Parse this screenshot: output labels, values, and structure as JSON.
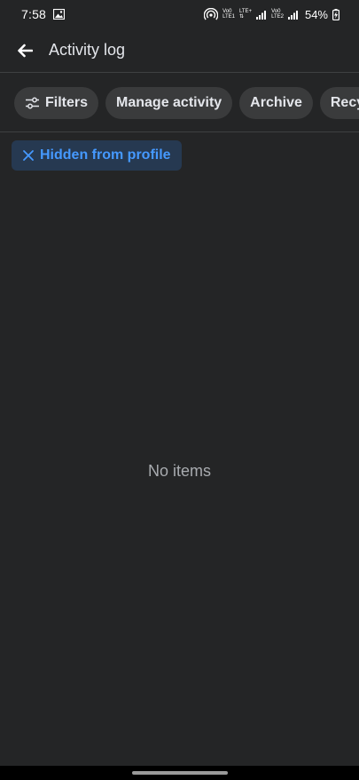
{
  "status_bar": {
    "time": "7:58",
    "sim1_top": "Vo0",
    "sim1_bottom": "LTE1",
    "sim1_extra": "LTE+",
    "sim2_top": "Vo0",
    "sim2_bottom": "LTE2",
    "battery": "54%"
  },
  "header": {
    "title": "Activity log"
  },
  "chips": {
    "filters": "Filters",
    "manage_activity": "Manage activity",
    "archive": "Archive",
    "recycle": "Recyc"
  },
  "active_filter": {
    "label": "Hidden from profile"
  },
  "empty_state": {
    "message": "No items"
  },
  "colors": {
    "background": "#242526",
    "chip": "#3a3b3c",
    "accent": "#4599ff",
    "filter_bg": "#263951"
  }
}
